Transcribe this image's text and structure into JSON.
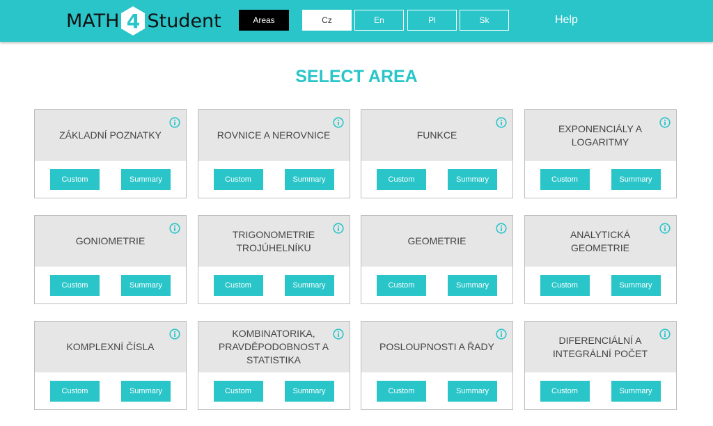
{
  "header": {
    "logo": {
      "left": "MATH",
      "digit": "4",
      "right": "Student"
    },
    "nav": {
      "areas": "Areas",
      "languages": [
        "Cz",
        "En",
        "Pl",
        "Sk"
      ],
      "active_language": "Cz",
      "help": "Help"
    }
  },
  "page_title": "SELECT AREA",
  "card_buttons": {
    "custom": "Custom",
    "summary": "Summary"
  },
  "areas": [
    {
      "title": "ZÁKLADNÍ POZNATKY"
    },
    {
      "title": "ROVNICE A NEROVNICE"
    },
    {
      "title": "FUNKCE"
    },
    {
      "title": "EXPONENCIÁLY A LOGARITMY"
    },
    {
      "title": "GONIOMETRIE"
    },
    {
      "title": "TRIGONOMETRIE TROJÚHELNÍKU"
    },
    {
      "title": "GEOMETRIE"
    },
    {
      "title": "ANALYTICKÁ GEOMETRIE"
    },
    {
      "title": "KOMPLEXNÍ ČÍSLA"
    },
    {
      "title": "KOMBINATORIKA, PRAVDĚPODOBNOST A STATISTIKA"
    },
    {
      "title": "POSLOUPNOSTI A ŘADY"
    },
    {
      "title": "DIFERENCIÁLNÍ A INTEGRÁLNÍ POČET"
    }
  ],
  "colors": {
    "accent": "#29c5c9",
    "card_header": "#e6e6e6",
    "nav_active_dark": "#000000"
  },
  "icons": {
    "card_info": "info-icon",
    "logo_badge": "hexagon-icon"
  }
}
